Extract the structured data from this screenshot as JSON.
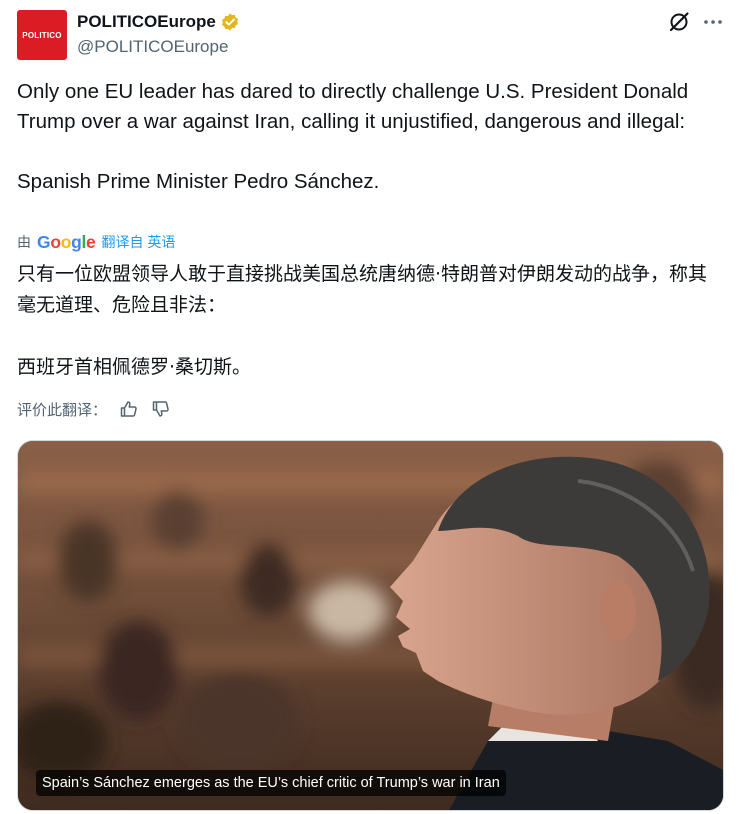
{
  "account": {
    "avatar_text": "POLITICO",
    "display_name": "POLITICOEurope",
    "handle": "@POLITICOEurope",
    "brand_color": "#dc1c24",
    "verified_color": "#e2b719"
  },
  "header_actions": {
    "grok_icon": "grok-icon",
    "more_icon": "more-icon"
  },
  "tweet": {
    "text": "Only one EU leader has dared to directly challenge U.S. President Donald Trump over a war against Iran, calling it unjustified, dangerous and illegal:\n\nSpanish Prime Minister Pedro Sánchez."
  },
  "translation": {
    "by_label": "由",
    "google_letters": [
      "G",
      "o",
      "o",
      "g",
      "l",
      "e"
    ],
    "from_label": "翻译自 英语",
    "text": "只有一位欧盟领导人敢于直接挑战美国总统唐纳德·特朗普对伊朗发动的战争，称其毫无道理、危险且非法：\n\n西班牙首相佩德罗·桑切斯。",
    "rate_label": "评价此翻译："
  },
  "media": {
    "caption": "Spain’s Sánchez emerges as the EU’s chief critic of Trump’s war in Iran"
  },
  "colors": {
    "text_primary": "#0f1419",
    "text_secondary": "#536471",
    "link": "#1d9bf0"
  }
}
